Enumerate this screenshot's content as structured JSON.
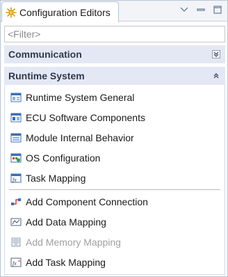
{
  "view": {
    "title": "Configuration Editors",
    "icon": "configuration-star-icon",
    "tools": [
      "view-menu-icon",
      "minimize-icon",
      "maximize-icon"
    ]
  },
  "filter": {
    "placeholder": "<Filter>",
    "value": ""
  },
  "sections": {
    "communication": {
      "title": "Communication",
      "state": "collapsed",
      "toggle_icon": "expand-down-icon"
    },
    "runtime": {
      "title": "Runtime System",
      "state": "expanded",
      "toggle_icon": "collapse-up-icon",
      "editors": [
        {
          "label": "Runtime System General",
          "icon": "runtime-general-icon"
        },
        {
          "label": "ECU Software Components",
          "icon": "ecu-components-icon"
        },
        {
          "label": "Module Internal Behavior",
          "icon": "internal-behavior-icon"
        },
        {
          "label": "OS Configuration",
          "icon": "os-configuration-icon"
        },
        {
          "label": "Task Mapping",
          "icon": "task-mapping-icon"
        }
      ],
      "actions": [
        {
          "label": "Add Component Connection",
          "icon": "add-connection-icon",
          "enabled": true
        },
        {
          "label": "Add Data Mapping",
          "icon": "add-data-mapping-icon",
          "enabled": true
        },
        {
          "label": "Add Memory Mapping",
          "icon": "add-memory-mapping-icon",
          "enabled": false
        },
        {
          "label": "Add Task Mapping",
          "icon": "add-task-mapping-icon",
          "enabled": true
        }
      ]
    }
  },
  "colors": {
    "section_header_bg": "#e4e8f4",
    "section_title": "#303a4b",
    "disabled_text": "#a0a0a0",
    "frame_border": "#b9c4d4"
  }
}
